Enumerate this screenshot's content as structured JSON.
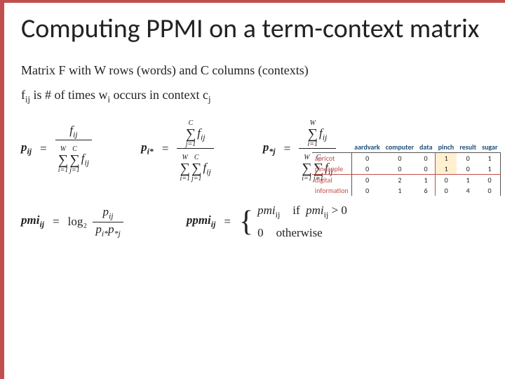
{
  "title": "Computing PPMI on a term-context matrix",
  "line1": "Matrix F with W rows (words) and C columns (contexts)",
  "line2_pre": "f",
  "line2_sub": "ij",
  "line2_mid": " is # of times w",
  "line2_sub2": "i",
  "line2_mid2": " occurs in context c",
  "line2_sub3": "j",
  "formulas": {
    "pij_lhs": "p",
    "pij_sub": "ij",
    "pistar_lhs": "p",
    "pistar_sub": "i*",
    "pstarj_lhs": "p",
    "pstarj_sub": "*j",
    "eq": "=",
    "fij": "f",
    "fij_sub": "ij",
    "C": "C",
    "W": "W",
    "j1": "j=1",
    "i1": "i=1",
    "pmi_lhs": "pmi",
    "pmi_sub": "ij",
    "log2": "log₂",
    "ppmi_lhs": "ppmi",
    "ppmi_sub": "ij",
    "if": "if",
    "gt0_a": "pmi",
    "gt0_b": "ij",
    "gt0_c": " > 0",
    "zero": "0",
    "otherwise": "otherwise"
  },
  "chart_data": {
    "type": "table",
    "columns": [
      "aardvark",
      "computer",
      "data",
      "pinch",
      "result",
      "sugar"
    ],
    "rows": [
      "apricot",
      "pineapple",
      "digital",
      "information"
    ],
    "values": [
      [
        0,
        0,
        0,
        1,
        0,
        1
      ],
      [
        0,
        0,
        0,
        1,
        0,
        1
      ],
      [
        0,
        2,
        1,
        0,
        1,
        0
      ],
      [
        0,
        1,
        6,
        0,
        4,
        0
      ]
    ],
    "highlighted_rows": [
      0,
      1
    ],
    "highlighted_col": 3
  }
}
